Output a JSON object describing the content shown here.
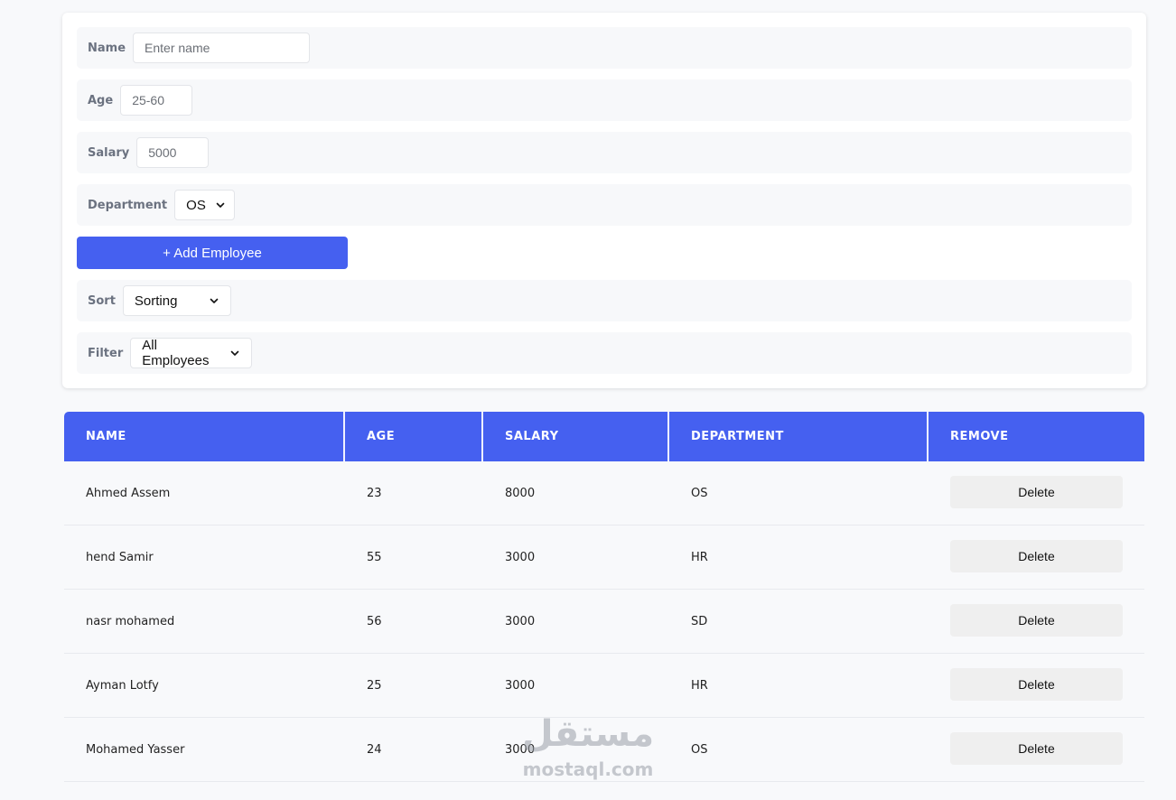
{
  "form": {
    "name": {
      "label": "Name",
      "placeholder": "Enter name",
      "value": ""
    },
    "age": {
      "label": "Age",
      "placeholder": "25-60",
      "value": ""
    },
    "salary": {
      "label": "Salary",
      "placeholder": "5000",
      "value": ""
    },
    "department": {
      "label": "Department",
      "selected": "OS"
    },
    "add_button": "+ Add Employee",
    "sort": {
      "label": "Sort",
      "selected": "Sorting"
    },
    "filter": {
      "label": "Filter",
      "selected": "All Employees"
    }
  },
  "table": {
    "headers": [
      "NAME",
      "AGE",
      "SALARY",
      "DEPARTMENT",
      "REMOVE"
    ],
    "rows": [
      {
        "name": "Ahmed Assem",
        "age": "23",
        "salary": "8000",
        "department": "OS",
        "action": "Delete"
      },
      {
        "name": "hend Samir",
        "age": "55",
        "salary": "3000",
        "department": "HR",
        "action": "Delete"
      },
      {
        "name": "nasr mohamed",
        "age": "56",
        "salary": "3000",
        "department": "SD",
        "action": "Delete"
      },
      {
        "name": "Ayman Lotfy",
        "age": "25",
        "salary": "3000",
        "department": "HR",
        "action": "Delete"
      },
      {
        "name": "Mohamed Yasser",
        "age": "24",
        "salary": "3000",
        "department": "OS",
        "action": "Delete"
      }
    ]
  },
  "watermark": {
    "arabic": "مستقل",
    "latin": "mostaql.com"
  },
  "colors": {
    "accent": "#4560f0",
    "row_bg": "#f7f8fa",
    "delete_bg": "#efefef"
  },
  "icons": {
    "select_arrow": "chevron-down-icon"
  }
}
